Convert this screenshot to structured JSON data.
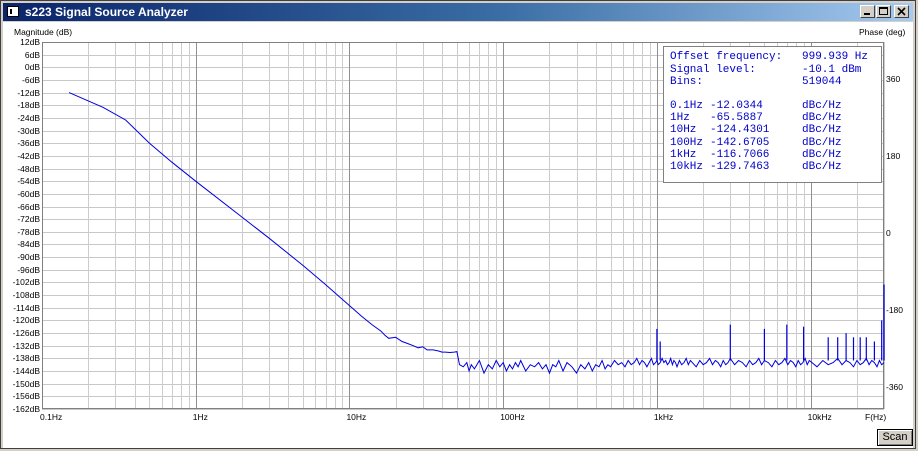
{
  "window": {
    "title": "s223 Signal Source Analyzer"
  },
  "axes": {
    "left_label": "Magnitude (dB)",
    "right_label": "Phase (deg)",
    "x_unit_label": "F(Hz)"
  },
  "chart_data": {
    "type": "line",
    "xscale": "log",
    "xlim": [
      0.1,
      30000
    ],
    "ylim": [
      -162,
      12
    ],
    "ytick_step": 6,
    "x_ticks": [
      "0.1Hz",
      "1Hz",
      "10Hz",
      "100Hz",
      "1kHz",
      "10kHz"
    ],
    "y_ticks": [
      "12dB",
      "6dB",
      "0dB",
      "-6dB",
      "-12dB",
      "-18dB",
      "-24dB",
      "-30dB",
      "-36dB",
      "-42dB",
      "-48dB",
      "-54dB",
      "-60dB",
      "-66dB",
      "-72dB",
      "-78dB",
      "-84dB",
      "-90dB",
      "-96dB",
      "-102dB",
      "-108dB",
      "-114dB",
      "-120dB",
      "-126dB",
      "-132dB",
      "-138dB",
      "-144dB",
      "-150dB",
      "-156dB",
      "-162dB"
    ],
    "phase_ticks": [
      "360",
      "180",
      "0",
      "-180",
      "-360"
    ],
    "phase_lim": [
      -360,
      360
    ],
    "grid": true,
    "series": [
      {
        "color": "#0000e0",
        "points": [
          [
            0.15,
            -12
          ],
          [
            0.25,
            -19
          ],
          [
            0.35,
            -25
          ],
          [
            0.5,
            -36
          ],
          [
            0.7,
            -45
          ],
          [
            1,
            -54
          ],
          [
            2,
            -71
          ],
          [
            3,
            -81
          ],
          [
            5,
            -94
          ],
          [
            7,
            -103
          ],
          [
            10,
            -113
          ],
          [
            12,
            -118
          ],
          [
            14,
            -122
          ],
          [
            16,
            -125
          ],
          [
            17,
            -127
          ],
          [
            18,
            -128.5
          ],
          [
            20,
            -128
          ],
          [
            22,
            -130
          ],
          [
            24,
            -131
          ],
          [
            26,
            -132
          ],
          [
            28,
            -133
          ],
          [
            30,
            -132.5
          ],
          [
            32,
            -134
          ],
          [
            35,
            -134
          ],
          [
            38,
            -134.5
          ],
          [
            40,
            -135
          ],
          [
            42,
            -135
          ],
          [
            45,
            -135.2
          ],
          [
            48,
            -135
          ],
          [
            50,
            -134.8
          ],
          [
            52,
            -141
          ],
          [
            55,
            -142
          ],
          [
            58,
            -140
          ],
          [
            60,
            -144
          ],
          [
            62,
            -141
          ],
          [
            65,
            -143
          ],
          [
            70,
            -139
          ],
          [
            75,
            -145
          ],
          [
            80,
            -141
          ],
          [
            85,
            -143
          ],
          [
            90,
            -139
          ],
          [
            95,
            -142
          ],
          [
            100,
            -140
          ],
          [
            105,
            -144
          ],
          [
            110,
            -141
          ],
          [
            115,
            -143
          ],
          [
            120,
            -140
          ],
          [
            125,
            -142
          ],
          [
            130,
            -139
          ],
          [
            140,
            -144
          ],
          [
            150,
            -141
          ],
          [
            160,
            -142
          ],
          [
            170,
            -140
          ],
          [
            180,
            -143
          ],
          [
            190,
            -141
          ],
          [
            200,
            -145
          ],
          [
            210,
            -141
          ],
          [
            220,
            -142
          ],
          [
            230,
            -139
          ],
          [
            245,
            -144
          ],
          [
            260,
            -140
          ],
          [
            280,
            -142
          ],
          [
            300,
            -145
          ],
          [
            320,
            -141
          ],
          [
            340,
            -143
          ],
          [
            360,
            -140
          ],
          [
            380,
            -144
          ],
          [
            400,
            -141
          ],
          [
            420,
            -142
          ],
          [
            440,
            -139
          ],
          [
            460,
            -143
          ],
          [
            480,
            -141
          ],
          [
            500,
            -142
          ],
          [
            530,
            -139
          ],
          [
            560,
            -141
          ],
          [
            590,
            -140
          ],
          [
            620,
            -142
          ],
          [
            650,
            -139
          ],
          [
            680,
            -141
          ],
          [
            710,
            -140
          ],
          [
            740,
            -138
          ],
          [
            770,
            -141
          ],
          [
            800,
            -139
          ],
          [
            830,
            -140
          ],
          [
            860,
            -142
          ],
          [
            890,
            -140
          ],
          [
            920,
            -138
          ],
          [
            950,
            -141
          ],
          [
            980,
            -140
          ],
          [
            1000,
            -139
          ],
          [
            1020,
            -141
          ],
          [
            1050,
            -140
          ],
          [
            1080,
            -138
          ],
          [
            1110,
            -140
          ],
          [
            1140,
            -139
          ],
          [
            1170,
            -141
          ],
          [
            1200,
            -140
          ],
          [
            1230,
            -138
          ],
          [
            1260,
            -141
          ],
          [
            1290,
            -139
          ],
          [
            1320,
            -140
          ],
          [
            1350,
            -142
          ],
          [
            1400,
            -139
          ],
          [
            1450,
            -141
          ],
          [
            1500,
            -140
          ],
          [
            1550,
            -138
          ],
          [
            1600,
            -141
          ],
          [
            1650,
            -139
          ],
          [
            1700,
            -140
          ],
          [
            1800,
            -142
          ],
          [
            1900,
            -139
          ],
          [
            2000,
            -141
          ],
          [
            2100,
            -140
          ],
          [
            2200,
            -138
          ],
          [
            2300,
            -141
          ],
          [
            2400,
            -139
          ],
          [
            2500,
            -140
          ],
          [
            2600,
            -142
          ],
          [
            2700,
            -139
          ],
          [
            2800,
            -141
          ],
          [
            2900,
            -140
          ],
          [
            3000,
            -138
          ],
          [
            3200,
            -141
          ],
          [
            3400,
            -139
          ],
          [
            3600,
            -140
          ],
          [
            3800,
            -142
          ],
          [
            4000,
            -139
          ],
          [
            4200,
            -141
          ],
          [
            4400,
            -140
          ],
          [
            4600,
            -138
          ],
          [
            4800,
            -141
          ],
          [
            5000,
            -139
          ],
          [
            5300,
            -140
          ],
          [
            5600,
            -142
          ],
          [
            5900,
            -139
          ],
          [
            6200,
            -141
          ],
          [
            6500,
            -140
          ],
          [
            6800,
            -138
          ],
          [
            7100,
            -141
          ],
          [
            7400,
            -139
          ],
          [
            7700,
            -140
          ],
          [
            8000,
            -142
          ],
          [
            8300,
            -139
          ],
          [
            8600,
            -141
          ],
          [
            8900,
            -140
          ],
          [
            9200,
            -138
          ],
          [
            9500,
            -141
          ],
          [
            9800,
            -139
          ],
          [
            10200,
            -140
          ],
          [
            11000,
            -142
          ],
          [
            12000,
            -139
          ],
          [
            13000,
            -141
          ],
          [
            14000,
            -140
          ],
          [
            15000,
            -138
          ],
          [
            16000,
            -141
          ],
          [
            17000,
            -139
          ],
          [
            18000,
            -140
          ],
          [
            19000,
            -142
          ],
          [
            20000,
            -139
          ],
          [
            21000,
            -141
          ],
          [
            22000,
            -140
          ],
          [
            23000,
            -138
          ],
          [
            24000,
            -141
          ],
          [
            25000,
            -139
          ],
          [
            26000,
            -140
          ],
          [
            27000,
            -142
          ],
          [
            28000,
            -139
          ],
          [
            29000,
            -141
          ],
          [
            30000,
            -140
          ]
        ],
        "spurs": [
          [
            1000,
            -124
          ],
          [
            1050,
            -130
          ],
          [
            3000,
            -122
          ],
          [
            5000,
            -124
          ],
          [
            7000,
            -122
          ],
          [
            9000,
            -123
          ],
          [
            13000,
            -128
          ],
          [
            15000,
            -128
          ],
          [
            17000,
            -126
          ],
          [
            19000,
            -128
          ],
          [
            21000,
            -128
          ],
          [
            23000,
            -128
          ],
          [
            26000,
            -130
          ],
          [
            29000,
            -120
          ],
          [
            30000,
            -103
          ]
        ]
      }
    ]
  },
  "info": {
    "rows": [
      {
        "key": "Offset frequency:",
        "val": "999.939 Hz"
      },
      {
        "key": "Signal level:",
        "val": "-10.1 dBm"
      },
      {
        "key": "Bins:",
        "val": "519044"
      }
    ],
    "noise": [
      {
        "freq": "0.1Hz",
        "val": "-12.0344",
        "unit": "dBc/Hz"
      },
      {
        "freq": "1Hz",
        "val": "-65.5887",
        "unit": "dBc/Hz"
      },
      {
        "freq": "10Hz",
        "val": "-124.4301",
        "unit": "dBc/Hz"
      },
      {
        "freq": "100Hz",
        "val": "-142.6705",
        "unit": "dBc/Hz"
      },
      {
        "freq": "1kHz",
        "val": "-116.7066",
        "unit": "dBc/Hz"
      },
      {
        "freq": "10kHz",
        "val": "-129.7463",
        "unit": "dBc/Hz"
      }
    ]
  },
  "buttons": {
    "scan": "Scan"
  }
}
